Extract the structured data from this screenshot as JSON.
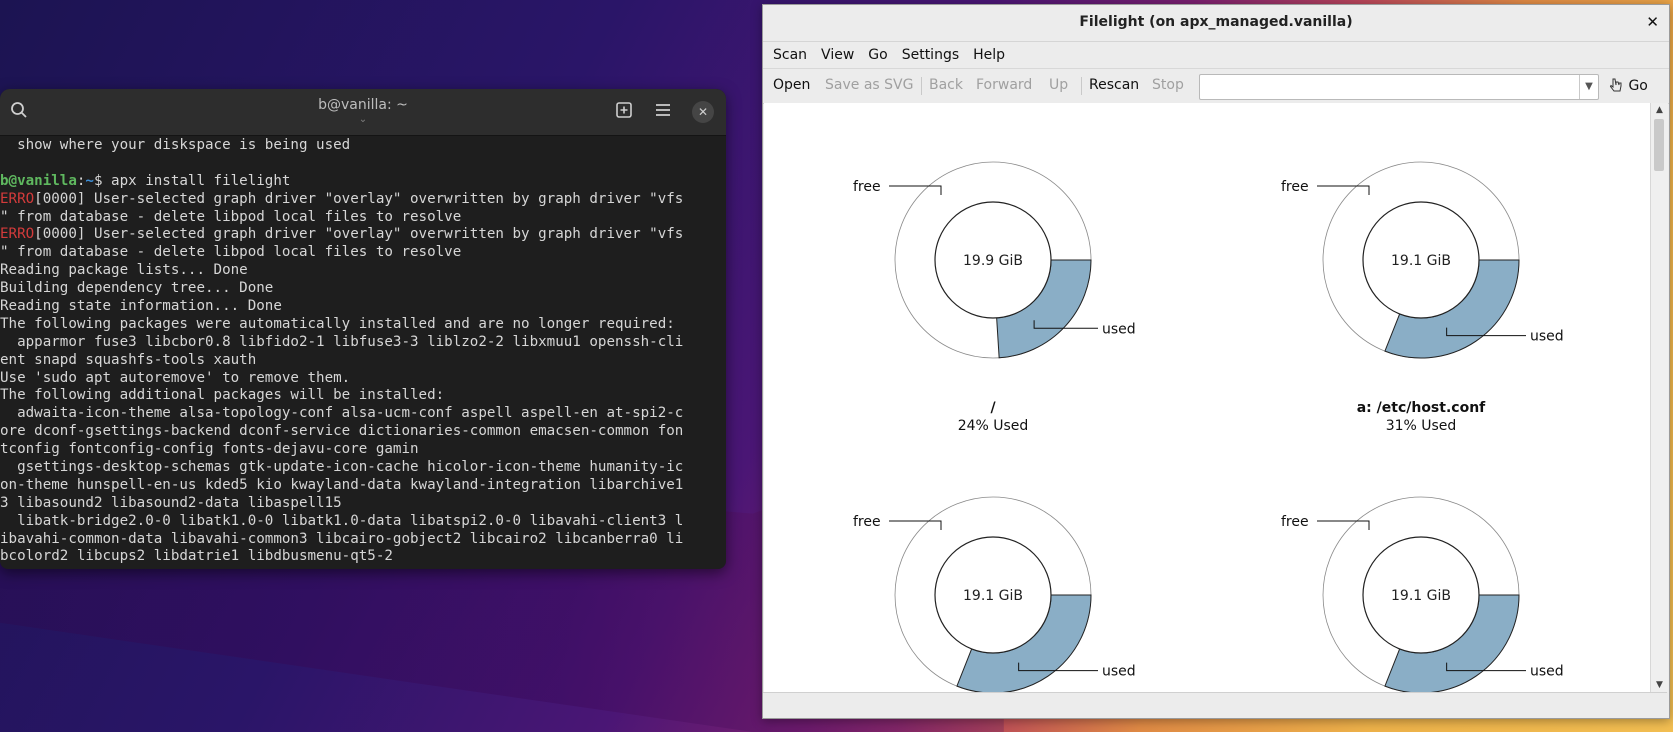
{
  "terminal": {
    "title": "b@vanilla: ~",
    "subtitle": "⌄",
    "lines": [
      {
        "parts": [
          {
            "t": "  show where your diskspace is being used",
            "c": ""
          }
        ]
      },
      {
        "parts": [
          {
            "t": "",
            "c": ""
          }
        ]
      },
      {
        "parts": [
          {
            "t": "b@vanilla",
            "c": "prompt-user"
          },
          {
            "t": ":",
            "c": ""
          },
          {
            "t": "~",
            "c": "prompt-path"
          },
          {
            "t": "$ apx install filelight",
            "c": ""
          }
        ]
      },
      {
        "parts": [
          {
            "t": "ERRO",
            "c": "err"
          },
          {
            "t": "[0000] User-selected graph driver \"overlay\" overwritten by graph driver \"vfs",
            "c": ""
          }
        ]
      },
      {
        "parts": [
          {
            "t": "\" from database - delete libpod local files to resolve",
            "c": ""
          }
        ]
      },
      {
        "parts": [
          {
            "t": "ERRO",
            "c": "err"
          },
          {
            "t": "[0000] User-selected graph driver \"overlay\" overwritten by graph driver \"vfs",
            "c": ""
          }
        ]
      },
      {
        "parts": [
          {
            "t": "\" from database - delete libpod local files to resolve",
            "c": ""
          }
        ]
      },
      {
        "parts": [
          {
            "t": "Reading package lists... Done",
            "c": ""
          }
        ]
      },
      {
        "parts": [
          {
            "t": "Building dependency tree... Done",
            "c": ""
          }
        ]
      },
      {
        "parts": [
          {
            "t": "Reading state information... Done",
            "c": ""
          }
        ]
      },
      {
        "parts": [
          {
            "t": "The following packages were automatically installed and are no longer required:",
            "c": ""
          }
        ]
      },
      {
        "parts": [
          {
            "t": "  apparmor fuse3 libcbor0.8 libfido2-1 libfuse3-3 liblzo2-2 libxmuu1 openssh-cli",
            "c": ""
          }
        ]
      },
      {
        "parts": [
          {
            "t": "ent snapd squashfs-tools xauth",
            "c": ""
          }
        ]
      },
      {
        "parts": [
          {
            "t": "Use 'sudo apt autoremove' to remove them.",
            "c": ""
          }
        ]
      },
      {
        "parts": [
          {
            "t": "The following additional packages will be installed:",
            "c": ""
          }
        ]
      },
      {
        "parts": [
          {
            "t": "  adwaita-icon-theme alsa-topology-conf alsa-ucm-conf aspell aspell-en at-spi2-c",
            "c": ""
          }
        ]
      },
      {
        "parts": [
          {
            "t": "ore dconf-gsettings-backend dconf-service dictionaries-common emacsen-common fon",
            "c": ""
          }
        ]
      },
      {
        "parts": [
          {
            "t": "tconfig fontconfig-config fonts-dejavu-core gamin",
            "c": ""
          }
        ]
      },
      {
        "parts": [
          {
            "t": "  gsettings-desktop-schemas gtk-update-icon-cache hicolor-icon-theme humanity-ic",
            "c": ""
          }
        ]
      },
      {
        "parts": [
          {
            "t": "on-theme hunspell-en-us kded5 kio kwayland-data kwayland-integration libarchive1",
            "c": ""
          }
        ]
      },
      {
        "parts": [
          {
            "t": "3 libasound2 libasound2-data libaspell15",
            "c": ""
          }
        ]
      },
      {
        "parts": [
          {
            "t": "  libatk-bridge2.0-0 libatk1.0-0 libatk1.0-data libatspi2.0-0 libavahi-client3 l",
            "c": ""
          }
        ]
      },
      {
        "parts": [
          {
            "t": "ibavahi-common-data libavahi-common3 libcairo-gobject2 libcairo2 libcanberra0 li",
            "c": ""
          }
        ]
      },
      {
        "parts": [
          {
            "t": "bcolord2 libcups2 libdatrie1 libdbusmenu-qt5-2",
            "c": ""
          }
        ]
      }
    ]
  },
  "filelight": {
    "title": "Filelight (on apx_managed.vanilla)",
    "close_glyph": "✕",
    "menu": [
      "Scan",
      "View",
      "Go",
      "Settings",
      "Help"
    ],
    "toolbar": {
      "open": "Open",
      "save_svg": "Save as SVG",
      "back": "Back",
      "forward": "Forward",
      "up": "Up",
      "rescan": "Rescan",
      "stop": "Stop",
      "go": "Go",
      "location_value": ""
    },
    "colors": {
      "used": "#8aaec6",
      "free": "#ffffff",
      "ring": "#222222"
    },
    "disks": [
      {
        "center": "19.9 GiB",
        "title": "/",
        "usage": "24% Used",
        "used_fraction": 0.24,
        "free_label": "free",
        "used_label": "used"
      },
      {
        "center": "19.1 GiB",
        "title": "a: /etc/host.conf",
        "usage": "31% Used",
        "used_fraction": 0.31,
        "free_label": "free",
        "used_label": "used"
      },
      {
        "center": "19.1 GiB",
        "title": "",
        "usage": "",
        "used_fraction": 0.31,
        "free_label": "free",
        "used_label": "used"
      },
      {
        "center": "19.1 GiB",
        "title": "",
        "usage": "",
        "used_fraction": 0.31,
        "free_label": "free",
        "used_label": "used"
      }
    ]
  }
}
